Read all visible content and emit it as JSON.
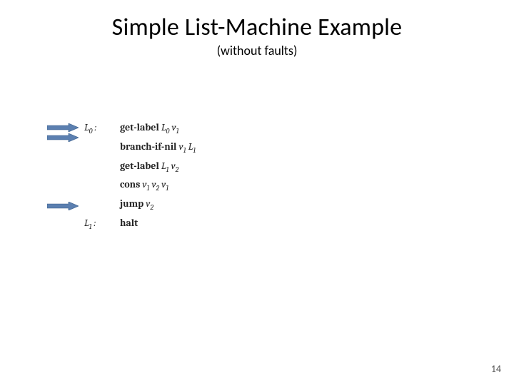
{
  "title": "Simple List-Machine Example",
  "subtitle": "(without faults)",
  "labels": {
    "L0": "L",
    "L0sub": "0",
    "L1": "L",
    "L1sub": "1",
    "colon": " :"
  },
  "code": {
    "r0": {
      "op": "get-label",
      "a1": "L",
      "a1s": "0",
      "a2": "v",
      "a2s": "1"
    },
    "r1": {
      "op": "branch-if-nil",
      "a1": "v",
      "a1s": "1",
      "a2": "L",
      "a2s": "1"
    },
    "r2": {
      "op": "get-label",
      "a1": "L",
      "a1s": "1",
      "a2": "v",
      "a2s": "2"
    },
    "r3": {
      "op": "cons",
      "a1": "v",
      "a1s": "1",
      "a2": "v",
      "a2s": "2",
      "a3": "v",
      "a3s": "1"
    },
    "r4": {
      "op": "jump",
      "a1": "v",
      "a1s": "2"
    },
    "r5": {
      "op": "halt"
    }
  },
  "pageNumber": "14",
  "arrowColor": "#5B7FB0",
  "arrowStroke": "#3A5F8A"
}
